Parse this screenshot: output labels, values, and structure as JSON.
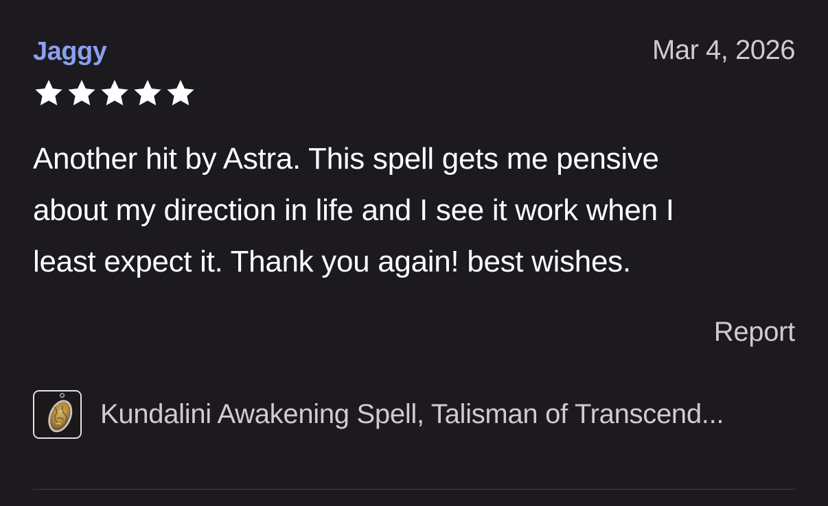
{
  "review": {
    "reviewer_name": "Jaggy",
    "date": "Mar 4, 2026",
    "rating": 5,
    "rating_max": 5,
    "text_lines": [
      "Another hit by Astra. This spell gets me pensive",
      "about my direction in life and I see it work when I",
      "least expect it. Thank you again! best wishes."
    ],
    "report_label": "Report"
  },
  "product": {
    "title": "Kundalini Awakening Spell, Talisman of Transcend...",
    "thumbnail_icon": "amber-stone-pendant-thumbnail"
  },
  "colors": {
    "background": "#1c1a1f",
    "reviewer_name": "#8aa0f0",
    "star": "#ffffff",
    "secondary_text": "#cfcbd0",
    "primary_text": "#ffffff"
  }
}
